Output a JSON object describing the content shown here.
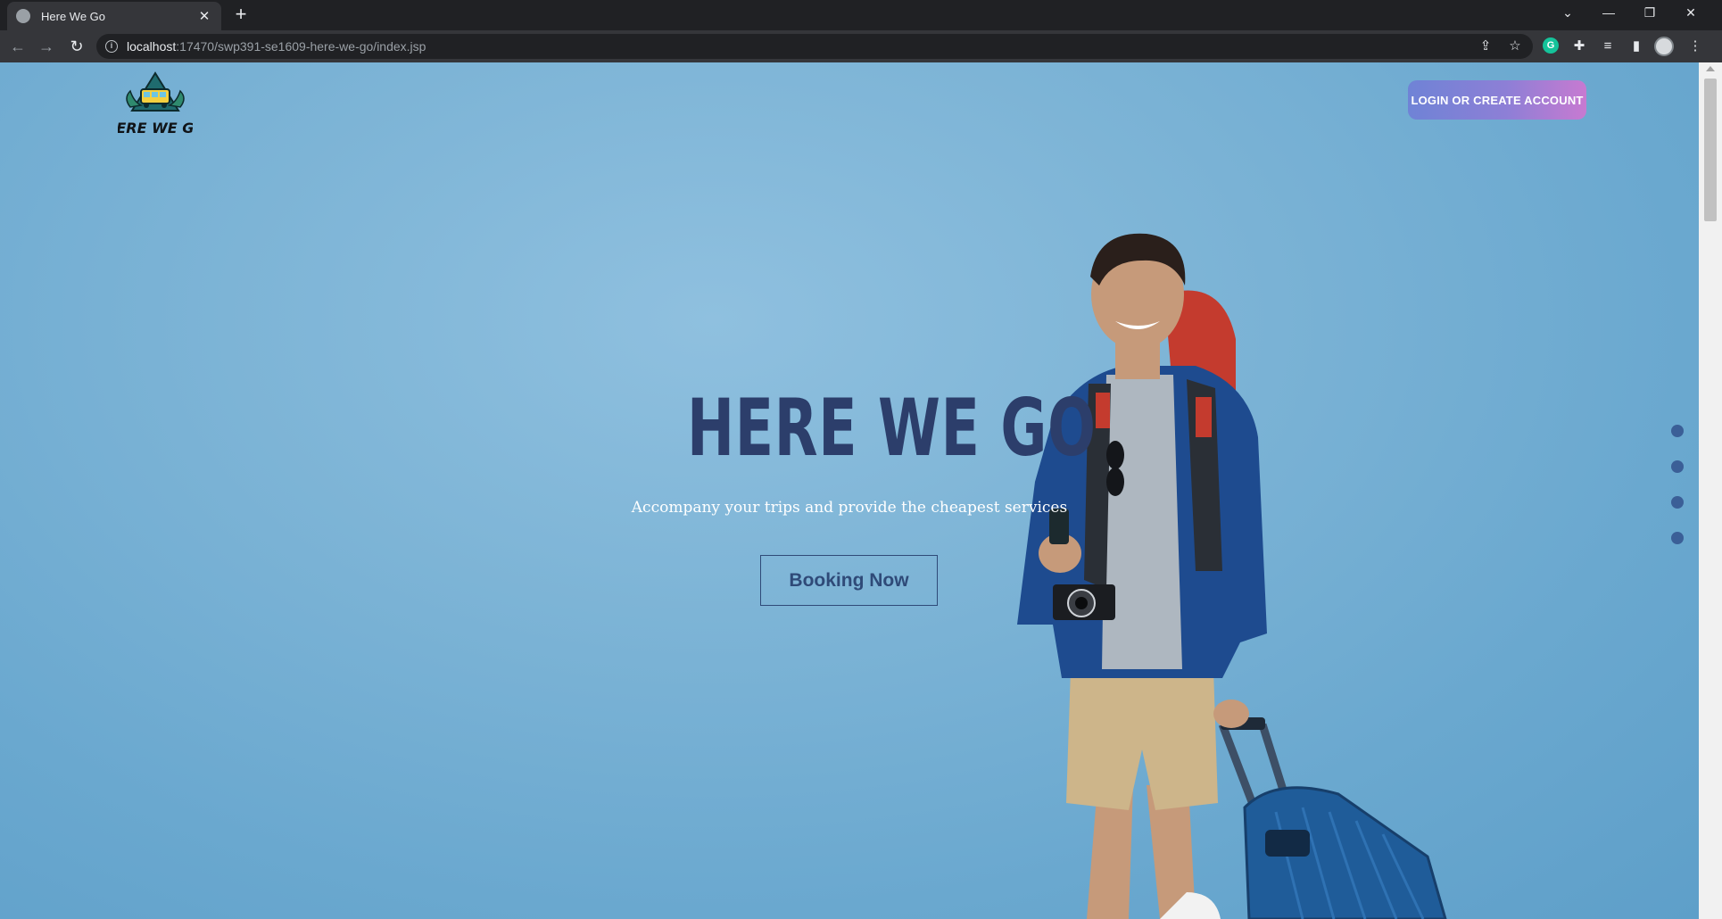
{
  "browser": {
    "tab_title": "Here We Go",
    "tab_close": "✕",
    "new_tab": "+",
    "url_host": "localhost",
    "url_path": ":17470/swp391-se1609-here-we-go/index.jsp",
    "nav_back": "←",
    "nav_forward": "→",
    "nav_reload": "↻",
    "win_min": "—",
    "win_restore": "❐",
    "win_close": "✕",
    "win_dropdown": "⌄",
    "icons": [
      "share-icon",
      "star-icon",
      "grammarly-icon",
      "extensions-icon",
      "media-icon",
      "sidepanel-icon",
      "profile-icon",
      "menu-icon"
    ]
  },
  "header": {
    "logo_text": "HERE WE GO",
    "login_label": "LOGIN OR CREATE ACCOUNT"
  },
  "hero": {
    "title": "HERE WE GO",
    "subtitle": "Accompany your trips and provide the cheapest services",
    "cta_label": "Booking Now"
  },
  "slider": {
    "dots": 4
  },
  "colors": {
    "background": "#7db4d6",
    "title": "#2c3e6b",
    "cta_border": "#2f4a78",
    "login_gradient_start": "#6f83d6",
    "login_gradient_end": "#c77ad1"
  }
}
